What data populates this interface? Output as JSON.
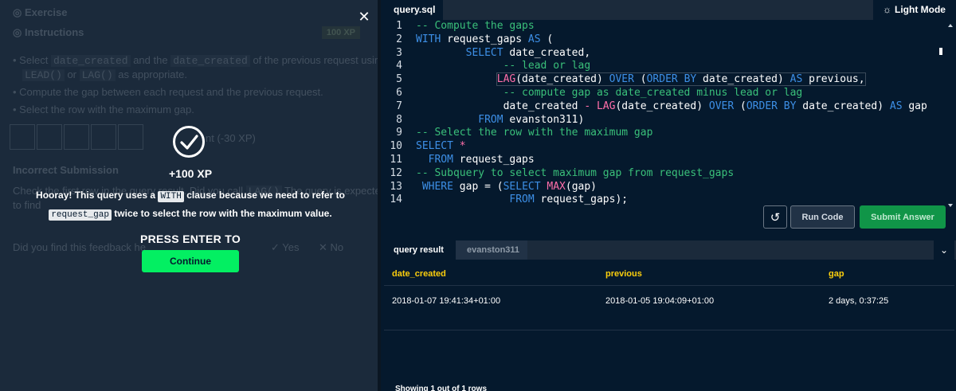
{
  "overlay": {
    "close_glyph": "✕",
    "xp": "+100 XP",
    "feedback_part1": "Hooray! This query uses a",
    "feedback_code1": "WITH",
    "feedback_part2": "clause because we need to refer to",
    "feedback_code2": "request_gap",
    "feedback_part3": "twice to select the row with the maximum value.",
    "press_enter": "PRESS ENTER TO",
    "continue_label": "Continue"
  },
  "background_panel": {
    "exercise": "Exercise",
    "instructions": "Instructions",
    "xp_badge": "100 XP",
    "bullet1_a": "Select",
    "bullet1_code1": "date_created",
    "bullet1_b": "and the",
    "bullet1_code2": "date_created",
    "bullet1_c": "of the previous request using",
    "bullet1_code3": "LEAD()",
    "bullet1_d": "or",
    "bullet1_code4": "LAG()",
    "bullet1_e": "as appropriate.",
    "bullet2": "Compute the gap between each request and the previous request.",
    "bullet3": "Select the row with the maximum gap.",
    "hint_label": "nt (-30 XP)",
    "incorrect_title": "Incorrect Submission",
    "incorrect_text_a": "Check the first row in the query result. Did you call",
    "incorrect_code": "LAG()",
    "incorrect_text_b": "The query is expected",
    "incorrect_text_c": "to find",
    "feedback_question": "Did you find this feedback he",
    "yes": "Yes",
    "no": "No"
  },
  "editor": {
    "tab_label": "query.sql",
    "light_mode_label": "Light Mode",
    "reset_glyph": "↺",
    "run_label": "Run Code",
    "submit_label": "Submit Answer"
  },
  "code_lines": [
    {
      "n": "1",
      "indent": "",
      "parts": [
        [
          "cm",
          "-- Compute the gaps"
        ]
      ]
    },
    {
      "n": "2",
      "indent": "",
      "parts": [
        [
          "kw",
          "WITH"
        ],
        [
          "tx",
          " request_gaps "
        ],
        [
          "kw",
          "AS"
        ],
        [
          "tx",
          " ("
        ]
      ]
    },
    {
      "n": "3",
      "indent": "        ",
      "parts": [
        [
          "kw",
          "SELECT"
        ],
        [
          "tx",
          " date_created,"
        ]
      ]
    },
    {
      "n": "4",
      "indent": "              ",
      "parts": [
        [
          "cm",
          "-- lead or lag"
        ]
      ]
    },
    {
      "n": "5",
      "indent": "             ",
      "parts": [
        [
          "fn",
          "LAG"
        ],
        [
          "tx",
          "(date_created) "
        ],
        [
          "kw",
          "OVER"
        ],
        [
          "tx",
          " ("
        ],
        [
          "kw",
          "ORDER BY"
        ],
        [
          "tx",
          " date_created) "
        ],
        [
          "kw",
          "AS"
        ],
        [
          "tx",
          " previous,"
        ]
      ]
    },
    {
      "n": "6",
      "indent": "              ",
      "parts": [
        [
          "cm",
          "-- compute gap as date_created minus lead or lag"
        ]
      ]
    },
    {
      "n": "7",
      "indent": "              ",
      "parts": [
        [
          "tx",
          "date_created "
        ],
        [
          "fn",
          "-"
        ],
        [
          "tx",
          " "
        ],
        [
          "fn",
          "LAG"
        ],
        [
          "tx",
          "(date_created) "
        ],
        [
          "kw",
          "OVER"
        ],
        [
          "tx",
          " ("
        ],
        [
          "kw",
          "ORDER BY"
        ],
        [
          "tx",
          " date_created) "
        ],
        [
          "kw",
          "AS"
        ],
        [
          "tx",
          " gap"
        ]
      ]
    },
    {
      "n": "8",
      "indent": "          ",
      "parts": [
        [
          "kw",
          "FROM"
        ],
        [
          "tx",
          " evanston311)"
        ]
      ]
    },
    {
      "n": "9",
      "indent": "",
      "parts": [
        [
          "cm",
          "-- Select the row with the maximum gap"
        ]
      ]
    },
    {
      "n": "10",
      "indent": "",
      "parts": [
        [
          "kw",
          "SELECT"
        ],
        [
          "tx",
          " "
        ],
        [
          "fn",
          "*"
        ]
      ]
    },
    {
      "n": "11",
      "indent": "  ",
      "parts": [
        [
          "kw",
          "FROM"
        ],
        [
          "tx",
          " request_gaps"
        ]
      ]
    },
    {
      "n": "12",
      "indent": "",
      "parts": [
        [
          "cm",
          "-- Subquery to select maximum gap from request_gaps"
        ]
      ]
    },
    {
      "n": "13",
      "indent": " ",
      "parts": [
        [
          "kw",
          "WHERE"
        ],
        [
          "tx",
          " gap = ("
        ],
        [
          "kw",
          "SELECT"
        ],
        [
          "tx",
          " "
        ],
        [
          "fn",
          "MAX"
        ],
        [
          "tx",
          "(gap)"
        ]
      ]
    },
    {
      "n": "14",
      "indent": "               ",
      "parts": [
        [
          "kw",
          "FROM"
        ],
        [
          "tx",
          " request_gaps);"
        ]
      ]
    }
  ],
  "result": {
    "tab_result": "query result",
    "tab_table": "evanston311",
    "collapse_glyph": "⌄",
    "columns": [
      "date_created",
      "previous",
      "gap"
    ],
    "row": [
      "2018-01-07 19:41:34+01:00",
      "2018-01-05 19:04:09+01:00",
      "2 days, 0:37:25"
    ],
    "status": "Showing 1 out of 1 rows"
  },
  "colors": {
    "accent_green": "#03ef62",
    "submit_green": "#109548",
    "header_yellow": "#fcce0d",
    "navy": "#05192d"
  }
}
